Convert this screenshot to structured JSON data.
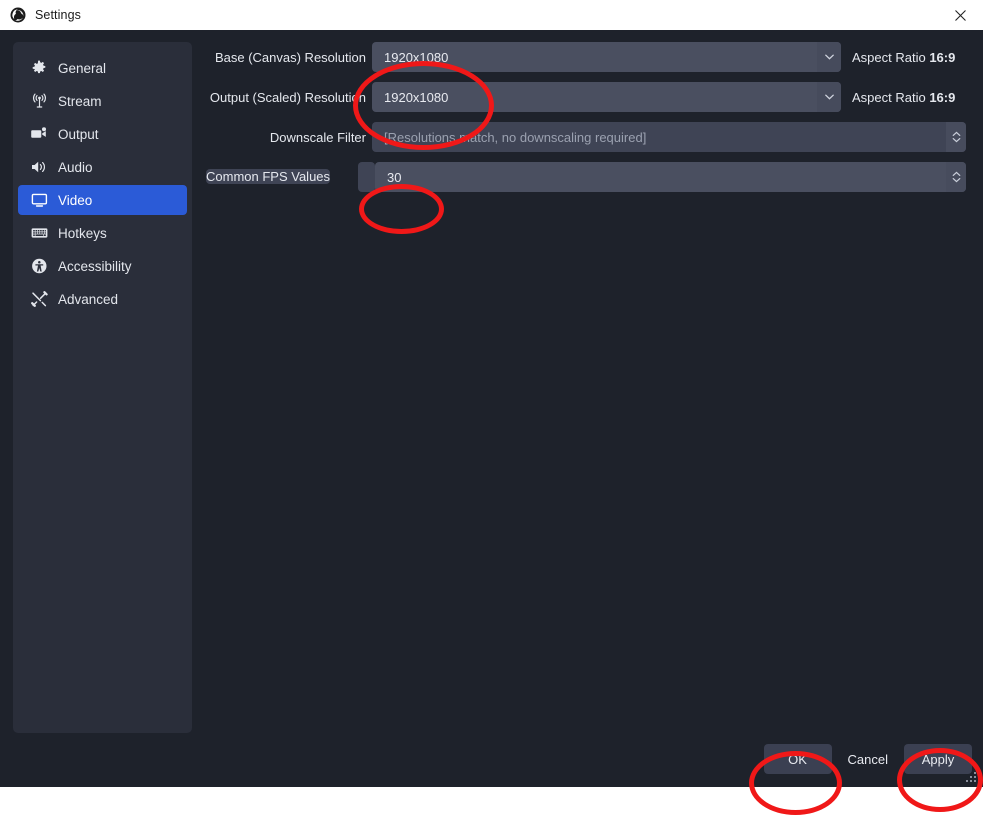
{
  "window": {
    "title": "Settings",
    "logo_icon": "obs-logo-icon",
    "close_icon": "close-icon"
  },
  "sidebar": {
    "items": [
      {
        "label": "General",
        "icon": "gear-icon",
        "active": false
      },
      {
        "label": "Stream",
        "icon": "broadcast-icon",
        "active": false
      },
      {
        "label": "Output",
        "icon": "video-camera-icon",
        "active": false
      },
      {
        "label": "Audio",
        "icon": "speaker-icon",
        "active": false
      },
      {
        "label": "Video",
        "icon": "monitor-icon",
        "active": true
      },
      {
        "label": "Hotkeys",
        "icon": "keyboard-icon",
        "active": false
      },
      {
        "label": "Accessibility",
        "icon": "accessibility-icon",
        "active": false
      },
      {
        "label": "Advanced",
        "icon": "tools-icon",
        "active": false
      }
    ]
  },
  "form": {
    "base_resolution": {
      "label": "Base (Canvas) Resolution",
      "value": "1920x1080",
      "aspect_prefix": "Aspect Ratio",
      "aspect_value": "16:9",
      "arrow_icon": "chevron-down-icon"
    },
    "output_resolution": {
      "label": "Output (Scaled) Resolution",
      "value": "1920x1080",
      "aspect_prefix": "Aspect Ratio",
      "aspect_value": "16:9",
      "arrow_icon": "chevron-down-icon"
    },
    "downscale_filter": {
      "label": "Downscale Filter",
      "value": "[Resolutions match, no downscaling required]",
      "arrow_icon": "spinner-arrows-icon"
    },
    "fps": {
      "label": "Common FPS Values",
      "value": "30",
      "arrow_icon": "spinner-arrows-icon"
    }
  },
  "footer": {
    "ok_label": "OK",
    "cancel_label": "Cancel",
    "apply_label": "Apply",
    "resize_grip_icon": "resize-grip-icon"
  },
  "annotations": {
    "color": "#f01818",
    "marks": [
      {
        "name": "resolution-highlight",
        "targets": "Base and Output resolution fields"
      },
      {
        "name": "fps-highlight",
        "targets": "Common FPS Values field"
      },
      {
        "name": "ok-highlight",
        "targets": "OK button"
      },
      {
        "name": "apply-highlight",
        "targets": "Apply button"
      }
    ]
  }
}
